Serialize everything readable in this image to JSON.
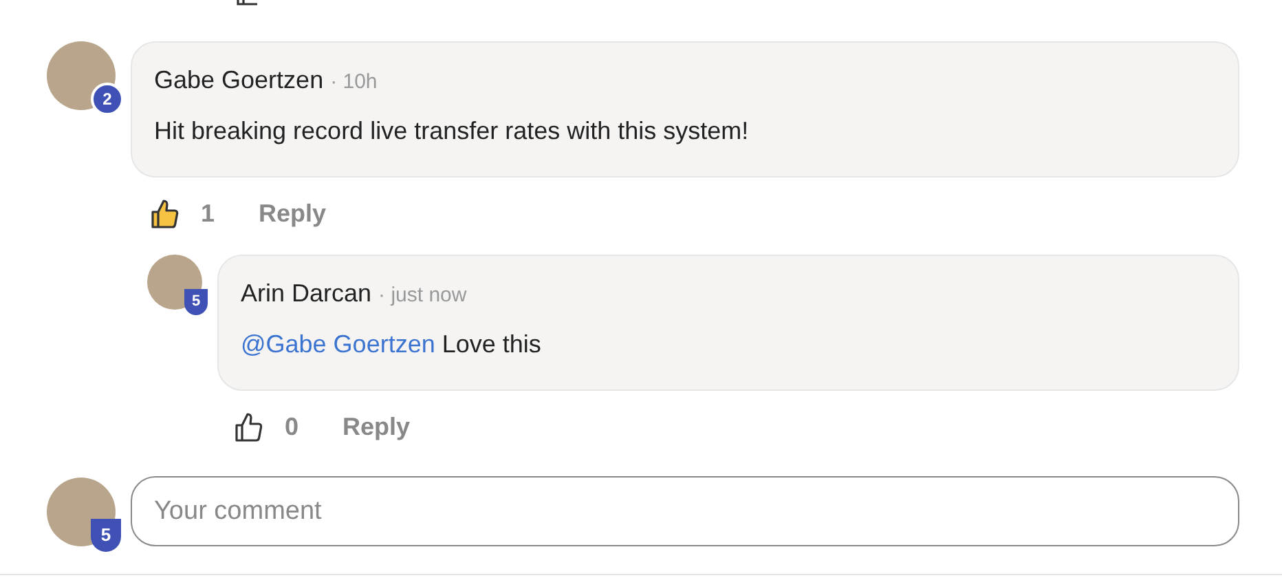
{
  "comments": [
    {
      "author": "Gabe Goertzen",
      "time": "· 10h",
      "badge": {
        "label": "2",
        "kind": "circle"
      },
      "body": "Hit breaking record live transfer rates with this system!",
      "liked": true,
      "likes": "1",
      "reply_label": "Reply",
      "replies": [
        {
          "author": "Arin Darcan",
          "time": "· just now",
          "badge": {
            "label": "5",
            "kind": "shield"
          },
          "mention": "@Gabe Goertzen",
          "body": "Love this",
          "liked": false,
          "likes": "0",
          "reply_label": "Reply"
        }
      ]
    }
  ],
  "composer": {
    "placeholder": "Your comment",
    "badge": {
      "label": "5",
      "kind": "shield"
    }
  }
}
